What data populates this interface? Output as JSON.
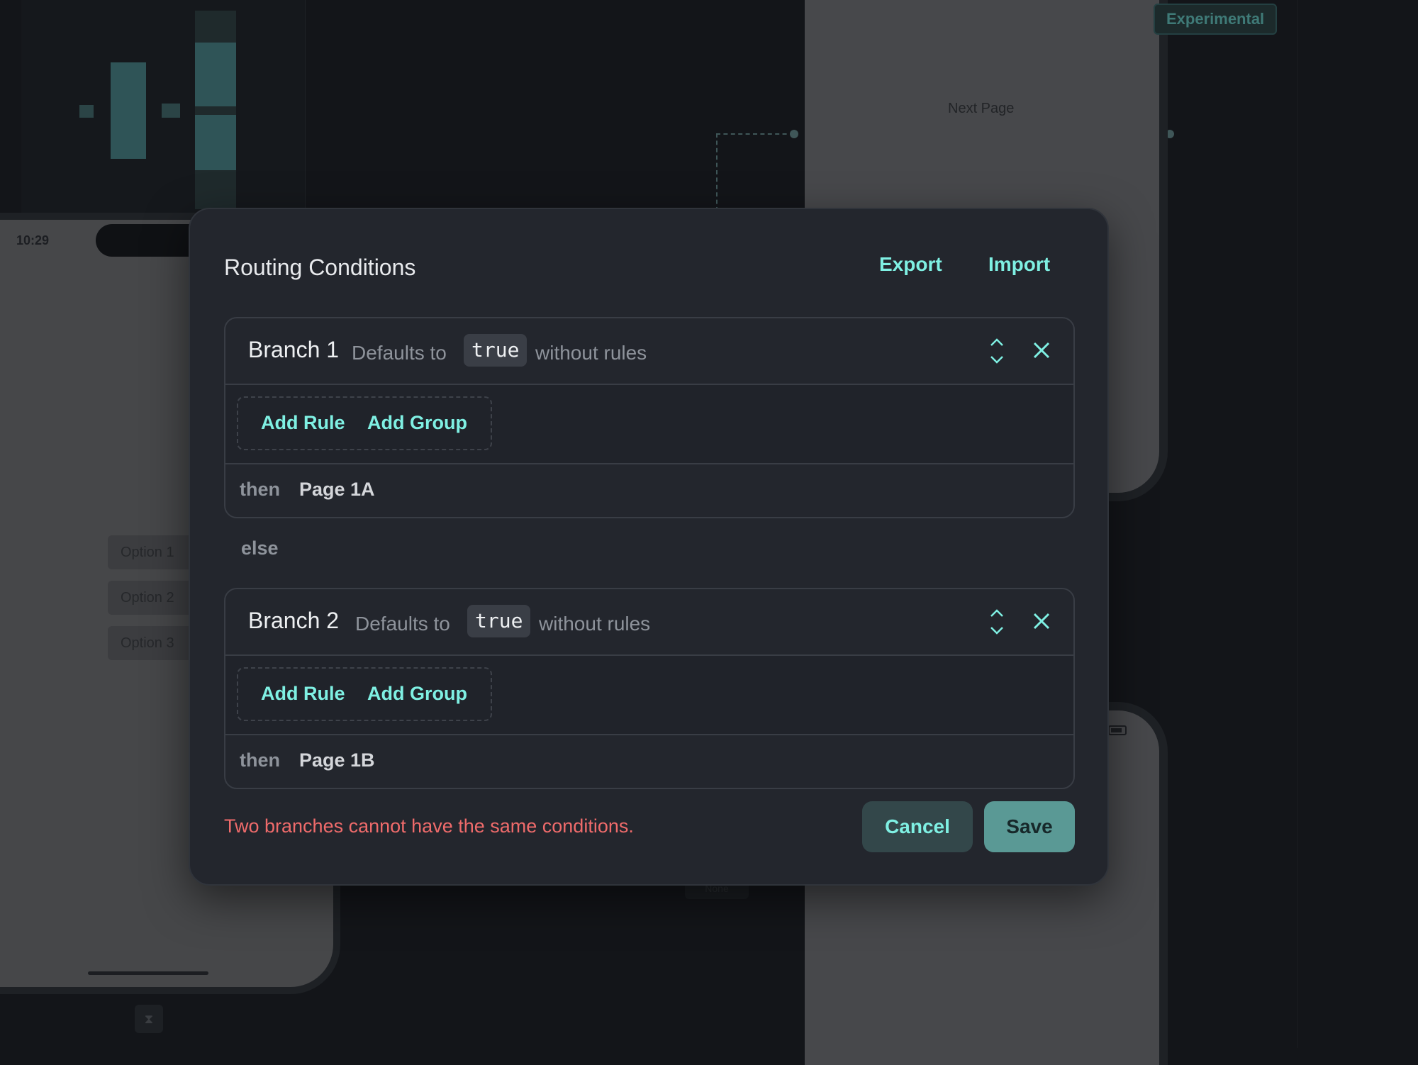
{
  "background": {
    "phone_left": {
      "time": "10:29",
      "options": [
        "Option 1",
        "Option 2",
        "Option 3"
      ]
    },
    "phone_right": {
      "label": "Next Page"
    },
    "badge": "Experimental",
    "faint_node_label": "None"
  },
  "modal": {
    "title": "Routing Conditions",
    "export_label": "Export",
    "import_label": "Import",
    "branches": [
      {
        "title": "Branch 1",
        "defaults_text": "Defaults to",
        "default_value": "true",
        "suffix_text": "without rules",
        "add_rule_label": "Add Rule",
        "add_group_label": "Add Group",
        "then_label": "then",
        "target_page": "Page 1A"
      },
      {
        "title": "Branch 2",
        "defaults_text": "Defaults to",
        "default_value": "true",
        "suffix_text": "without rules",
        "add_rule_label": "Add Rule",
        "add_group_label": "Add Group",
        "then_label": "then",
        "target_page": "Page 1B"
      }
    ],
    "else_label": "else",
    "error_message": "Two branches cannot have the same conditions.",
    "cancel_label": "Cancel",
    "save_label": "Save"
  },
  "colors": {
    "accent": "#7ff0e3",
    "error": "#ef6b6b",
    "save_button": "#5a9995",
    "modal_bg": "#23262d"
  }
}
